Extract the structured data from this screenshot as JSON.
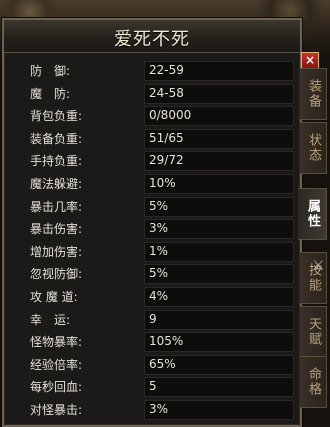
{
  "window": {
    "title": "爱死不死"
  },
  "close_label": "×",
  "stats": [
    {
      "label": "防　御:",
      "value": "22-59"
    },
    {
      "label": "魔　防:",
      "value": "24-58"
    },
    {
      "label": "背包负重:",
      "value": "0/8000"
    },
    {
      "label": "装备负重:",
      "value": "51/65"
    },
    {
      "label": "手持负重:",
      "value": "29/72"
    },
    {
      "label": "魔法躲避:",
      "value": "10%"
    },
    {
      "label": "暴击几率:",
      "value": "5%"
    },
    {
      "label": "暴击伤害:",
      "value": "3%"
    },
    {
      "label": "增加伤害:",
      "value": "1%"
    },
    {
      "label": "忽视防御:",
      "value": "5%"
    },
    {
      "label": "攻 魔 道:",
      "value": "4%"
    },
    {
      "label": "幸　运:",
      "value": "9"
    },
    {
      "label": "怪物暴率:",
      "value": "105%"
    },
    {
      "label": "经验倍率:",
      "value": "65%"
    },
    {
      "label": "每秒回血:",
      "value": "5"
    },
    {
      "label": "对怪暴击:",
      "value": "3%"
    }
  ],
  "tabs": [
    {
      "label": "装备",
      "active": false
    },
    {
      "label": "状态",
      "active": false
    },
    {
      "label": "属性",
      "active": true
    },
    {
      "label": "技能",
      "active": false
    },
    {
      "label": "天赋",
      "active": false
    },
    {
      "label": "命格",
      "active": false
    }
  ],
  "colors": {
    "panel_bg": "#1b1a18",
    "close_red": "#c8332a",
    "text": "#e6e1d6"
  }
}
